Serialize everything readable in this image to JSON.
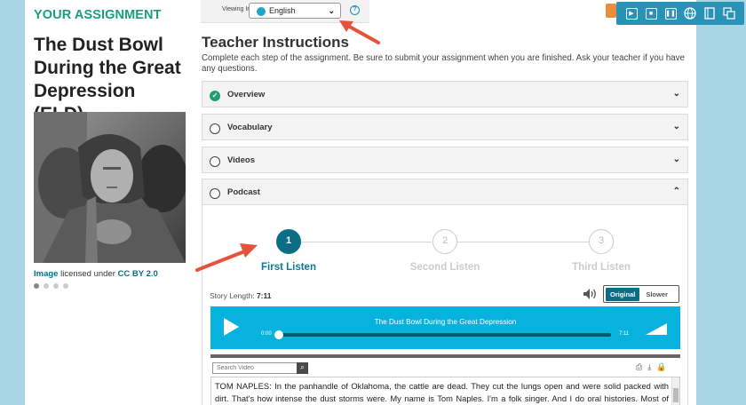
{
  "sidebar": {
    "heading": "YOUR ASSIGNMENT",
    "title": "The Dust Bowl During the Great Depression (ELD)",
    "credit_link": "Image",
    "credit_text": "licensed under",
    "license": "CC BY 2.0",
    "carousel_dots": 4,
    "active_dot": 0
  },
  "viewbar": {
    "label": "Viewing In",
    "language": "English"
  },
  "toolbar": {
    "icons": [
      "play-icon",
      "stop-icon",
      "pause-icon",
      "globe-icon",
      "dictionary-icon",
      "translate-icon"
    ]
  },
  "main": {
    "heading": "Teacher Instructions",
    "instructions": "Complete each step of the assignment. Be sure to submit your assignment when you are finished. Ask your teacher if you have any questions.",
    "sections": [
      {
        "label": "Overview",
        "done": true,
        "expanded": false
      },
      {
        "label": "Vocabulary",
        "done": false,
        "expanded": false
      },
      {
        "label": "Videos",
        "done": false,
        "expanded": false
      },
      {
        "label": "Podcast",
        "done": false,
        "expanded": true
      }
    ]
  },
  "podcast": {
    "steps": [
      {
        "num": "1",
        "label": "First Listen",
        "active": true
      },
      {
        "num": "2",
        "label": "Second Listen",
        "active": false
      },
      {
        "num": "3",
        "label": "Third Listen",
        "active": false
      }
    ],
    "story_length_label": "Story Length:",
    "story_length": "7:11",
    "speed_options": [
      "Original",
      "Slower"
    ],
    "selected_speed": "Original",
    "player": {
      "title": "The Dust Bowl During the Great Depression",
      "current_time": "0:00",
      "duration": "7:11",
      "progress": 0
    },
    "search_placeholder": "Search Video",
    "transcript": "TOM NAPLES: In the panhandle of Oklahoma, the cattle are dead. They cut the lungs open and were solid packed with dirt. That's how intense the dust storms were. My name is Tom Naples. I'm a folk singer. And I do oral histories. Most of what I have"
  },
  "colors": {
    "accent": "#18a07d",
    "brand_blue": "#2893b7",
    "player_blue": "#08b2de",
    "step_active": "#0c6e86",
    "arrow": "#e5533d"
  }
}
